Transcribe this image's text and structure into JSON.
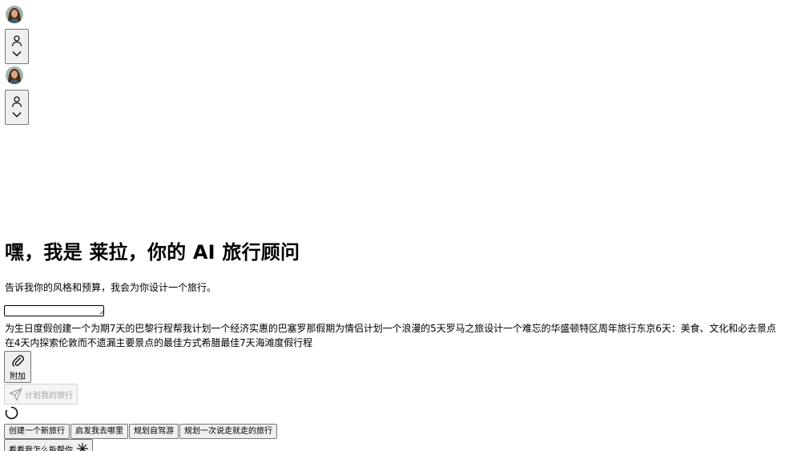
{
  "header": {
    "avatar_1": {
      "icon": "user-avatar-photo"
    },
    "profile_button_1": {
      "icons": [
        "person-icon",
        "chevron-down-icon"
      ]
    },
    "avatar_2": {
      "icon": "user-avatar-photo"
    },
    "profile_button_2": {
      "icons": [
        "person-icon",
        "chevron-down-icon"
      ]
    }
  },
  "hero": {
    "title": "嘿，我是 莱拉，你的 AI 旅行顾问",
    "subtitle": "告诉我你的风格和预算，我会为你设计一个旅行。"
  },
  "prompt": {
    "value": "",
    "placeholder": ""
  },
  "suggestions": [
    "为生日度假创建一个为期7天的巴黎行程",
    "帮我计划一个经济实惠的巴塞罗那假期",
    "为情侣计划一个浪漫的5天罗马之旅",
    "设计一个难忘的华盛顿特区周年旅行",
    "东京6天：美食、文化和必去景点",
    "在4天内探索伦敦而不遗漏主要景点的最佳方式",
    "希腊最佳7天海滩度假行程"
  ],
  "actions": {
    "attach_label": "附加",
    "attach_icon": "paperclip-icon",
    "plan_label": "计划我的旅行",
    "plan_icon": "send-icon",
    "plan_disabled": true,
    "loading_icon": "spinner-icon"
  },
  "quick_actions": [
    "创建一个新旅行",
    "启发我去哪里",
    "规划自驾游",
    "规划一次说走就走的旅行"
  ],
  "help": {
    "label": "看看我怎么能帮你",
    "icon": "sparkle-icon"
  },
  "colors": {
    "button_bg": "#efefef",
    "button_border": "#767676",
    "disabled_text": "#a6a6a6"
  }
}
